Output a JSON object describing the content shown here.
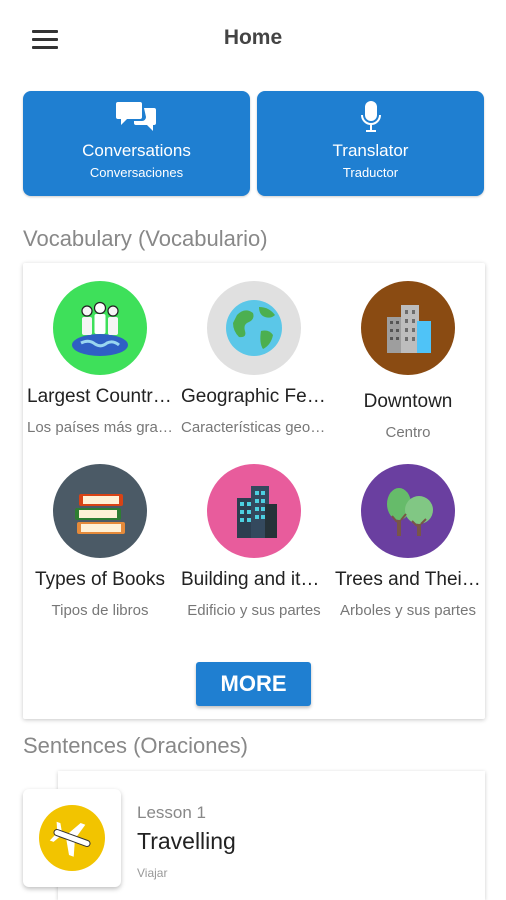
{
  "appbar": {
    "title": "Home",
    "menu_icon": "hamburger-menu-icon"
  },
  "features": [
    {
      "label": "Conversations",
      "sublabel": "Conversaciones",
      "icon": "chat-bubbles-icon"
    },
    {
      "label": "Translator",
      "sublabel": "Traductor",
      "icon": "microphone-icon"
    }
  ],
  "vocabulary": {
    "title": "Vocabulary (Vocabulario)",
    "items": [
      {
        "name": "Largest Countries",
        "sub": "Los países más grandes",
        "icon": "people-on-globe-icon",
        "color": "#3ee05a"
      },
      {
        "name": "Geographic Features",
        "sub": "Características geográficas",
        "icon": "earth-globe-icon",
        "color": "#e0e0e0"
      },
      {
        "name": "Downtown",
        "sub": "Centro",
        "icon": "city-buildings-icon",
        "color": "#8a4b12"
      },
      {
        "name": "Types of Books",
        "sub": "Tipos de libros",
        "icon": "book-stack-icon",
        "color": "#4b5a66"
      },
      {
        "name": "Building and its parts",
        "sub": "Edificio y sus partes",
        "icon": "skyscraper-icon",
        "color": "#e85c9c"
      },
      {
        "name": "Trees and Their Parts",
        "sub": "Arboles y sus partes",
        "icon": "trees-icon",
        "color": "#6a3fa0"
      }
    ],
    "more_label": "MORE"
  },
  "sentences": {
    "title": "Sentences (Oraciones)",
    "lessons": [
      {
        "number": "Lesson 1",
        "name": "Travelling",
        "sub": "Viajar",
        "icon": "airplane-icon",
        "color": "#f2c400"
      }
    ]
  },
  "colors": {
    "primary": "#1f7fd1",
    "section_title": "#888888"
  }
}
